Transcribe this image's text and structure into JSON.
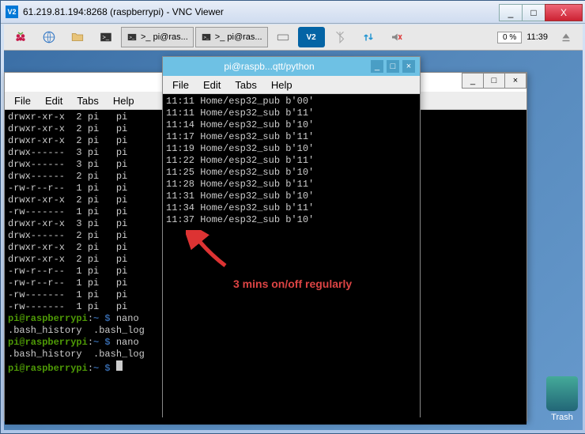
{
  "window": {
    "title": "61.219.81.194:8268 (raspberrypi) - VNC Viewer",
    "icon_label": "V2",
    "min": "_",
    "max": "□",
    "close": "X"
  },
  "taskbar": {
    "tasks": [
      ">_ pi@ras...",
      ">_ pi@ras..."
    ],
    "zoom": "0 %",
    "clock": "11:39"
  },
  "menu": {
    "file": "File",
    "edit": "Edit",
    "tabs": "Tabs",
    "help": "Help"
  },
  "term_front": {
    "title": "pi@raspb...qtt/python",
    "lines": [
      "11:11 Home/esp32_pub b'00'",
      "11:11 Home/esp32_sub b'11'",
      "11:14 Home/esp32_sub b'10'",
      "11:17 Home/esp32_sub b'11'",
      "11:19 Home/esp32_sub b'10'",
      "11:22 Home/esp32_sub b'11'",
      "11:25 Home/esp32_sub b'10'",
      "11:28 Home/esp32_sub b'11'",
      "11:31 Home/esp32_sub b'10'",
      "11:34 Home/esp32_sub b'11'",
      "11:37 Home/esp32_sub b'10'"
    ]
  },
  "term_back": {
    "lines": [
      "drwxr-xr-x  2 pi   pi",
      "drwxr-xr-x  2 pi   pi",
      "drwxr-xr-x  2 pi   pi",
      "drwx------  3 pi   pi",
      "drwx------  3 pi   pi",
      "drwx------  2 pi   pi",
      "-rw-r--r--  1 pi   pi",
      "drwxr-xr-x  2 pi   pi",
      "-rw-------  1 pi   pi",
      "drwxr-xr-x  3 pi   pi",
      "drwx------  2 pi   pi",
      "drwxr-xr-x  2 pi   pi",
      "drwxr-xr-x  2 pi   pi",
      "-rw-r--r--  1 pi   pi",
      "-rw-r--r--  1 pi   pi",
      "-rw-------  1 pi   pi",
      "-rw-------  1 pi   pi"
    ],
    "prompt_user": "pi@raspberrypi",
    "prompt_sep": ":",
    "prompt_path": "~ $",
    "cmd1": " nano",
    "hist1": ".bash_history  .bash_log",
    "cmd2": " nano",
    "hist2": ".bash_history  .bash_log",
    "cmd3": " "
  },
  "annotation": "3 mins on/off regularly",
  "trash": "Trash"
}
